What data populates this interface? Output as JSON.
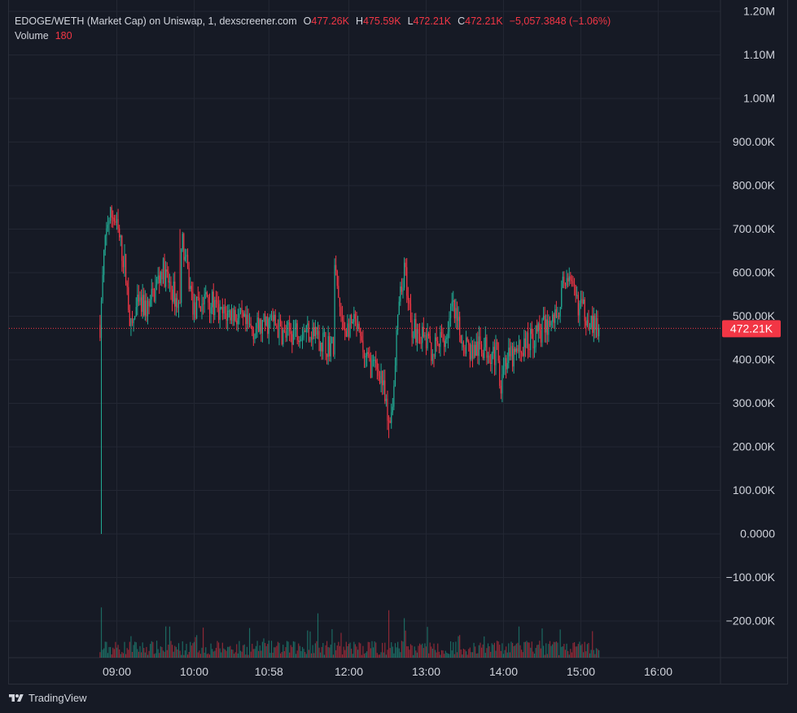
{
  "legend": {
    "symbol": "EDOGE/WETH (Market Cap) on Uniswap, 1, dexscreener.com",
    "o_label": "O",
    "o_value": "477.26K",
    "h_label": "H",
    "h_value": "475.59K",
    "l_label": "L",
    "l_value": "472.21K",
    "c_label": "C",
    "c_value": "472.21K",
    "change": "−5,057.3848 (−1.06%)",
    "volume_label": "Volume",
    "volume_value": "180"
  },
  "footer": {
    "brand": "TradingView"
  },
  "colors": {
    "up": "#22ab94",
    "down": "#f23645",
    "grid": "#232733",
    "axis_text": "#d1d4dc",
    "background": "#161a25"
  },
  "chart_data": {
    "type": "candlestick",
    "y_ticks": [
      "1.20M",
      "1.10M",
      "1.00M",
      "900.00K",
      "800.00K",
      "700.00K",
      "600.00K",
      "500.00K",
      "400.00K",
      "300.00K",
      "200.00K",
      "100.00K",
      "0.0000",
      "−100.00K",
      "−200.00K"
    ],
    "y_tick_values": [
      1200000,
      1100000,
      1000000,
      900000,
      800000,
      700000,
      600000,
      500000,
      400000,
      300000,
      200000,
      100000,
      0,
      -100000,
      -200000
    ],
    "x_ticks": [
      "09:00",
      "10:00",
      "10:58",
      "12:00",
      "13:00",
      "14:00",
      "15:00",
      "16:00"
    ],
    "x_tick_minutes": [
      540,
      600,
      658,
      720,
      780,
      840,
      900,
      960
    ],
    "current_price_label": "472.21K",
    "current_price": 472210,
    "start_minute": 527,
    "end_minute": 914,
    "grid": true,
    "key_points": [
      {
        "time": "08:47",
        "value": 0,
        "note": "low wick"
      },
      {
        "time": "08:57",
        "value": 735000
      },
      {
        "time": "09:49",
        "value": 700000
      },
      {
        "time": "11:48",
        "value": 630000
      },
      {
        "time": "12:30",
        "value": 220000
      },
      {
        "time": "12:43",
        "value": 635000
      },
      {
        "time": "13:58",
        "value": 350000
      },
      {
        "time": "14:48",
        "value": 615000
      },
      {
        "time": "15:11",
        "value": 472210
      }
    ]
  }
}
